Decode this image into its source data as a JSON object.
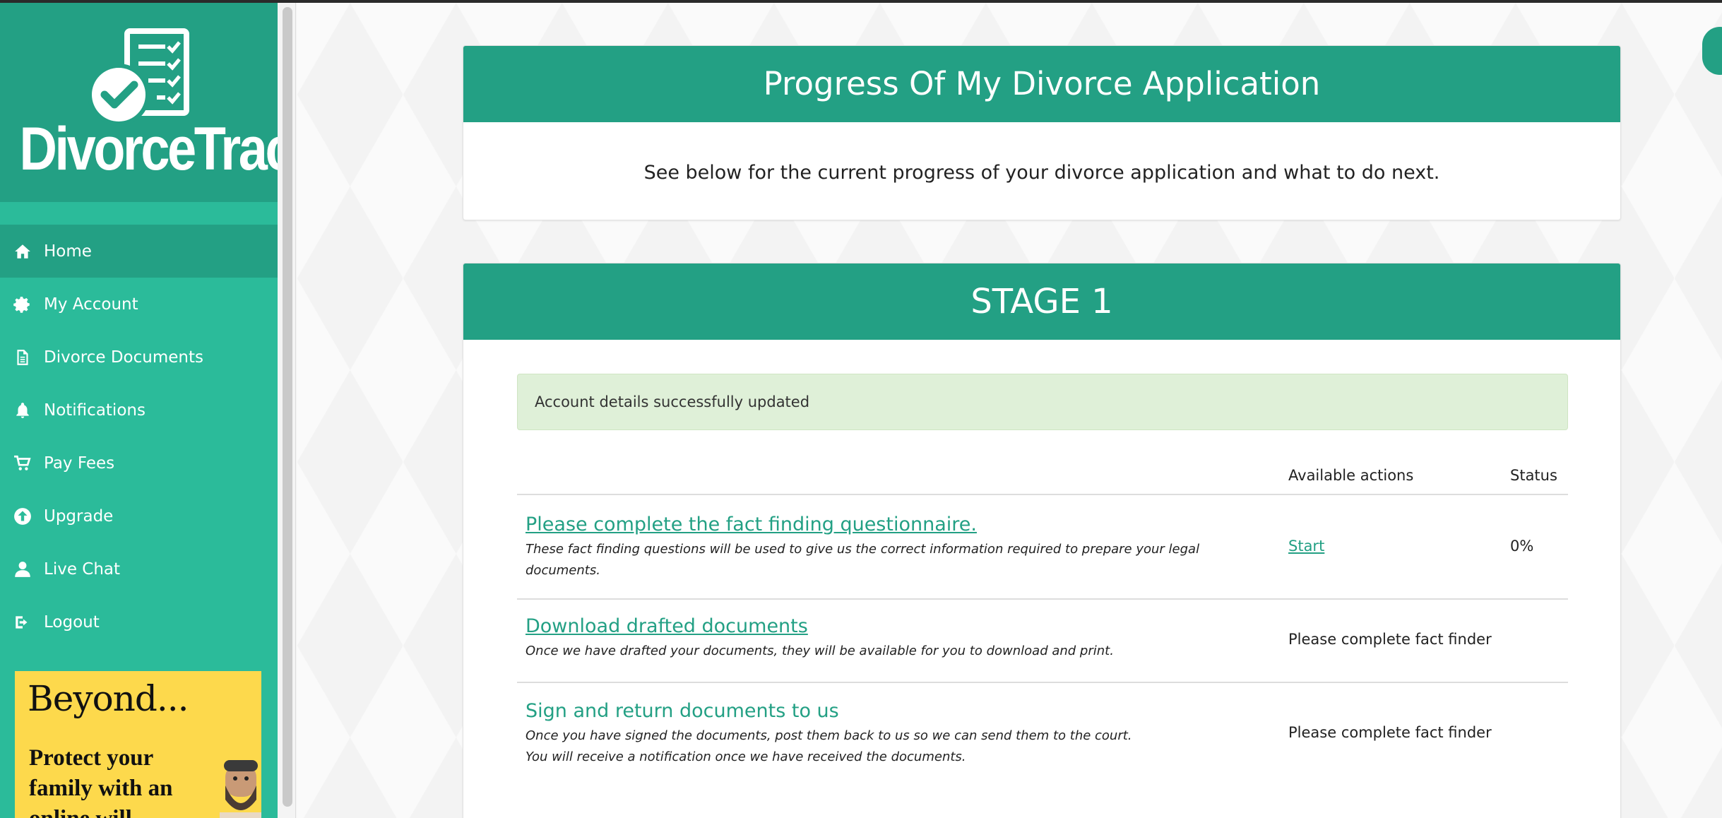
{
  "brand": {
    "name": "DivorceTrack"
  },
  "sidebar": {
    "items": [
      {
        "label": "Home",
        "icon": "home-icon",
        "active": true
      },
      {
        "label": "My Account",
        "icon": "gear-icon"
      },
      {
        "label": "Divorce Documents",
        "icon": "document-icon"
      },
      {
        "label": "Notifications",
        "icon": "bell-icon"
      },
      {
        "label": "Pay Fees",
        "icon": "cart-icon"
      },
      {
        "label": "Upgrade",
        "icon": "upload-icon"
      },
      {
        "label": "Live Chat",
        "icon": "user-icon"
      },
      {
        "label": "Logout",
        "icon": "logout-icon"
      }
    ]
  },
  "ad": {
    "title": "Beyond...",
    "body": "Protect your family with an online will"
  },
  "progress": {
    "title": "Progress Of My Divorce Application",
    "subtitle": "See below for the current progress of your divorce application and what to do next."
  },
  "stage": {
    "title": "STAGE 1",
    "alert": "Account details successfully updated",
    "headers": {
      "actions": "Available actions",
      "status": "Status"
    },
    "rows": [
      {
        "title": "Please complete the fact finding questionnaire.",
        "desc": "These fact finding questions will be used to give us the correct information required to prepare your legal documents.",
        "action": "Start",
        "status": "0%"
      },
      {
        "title": "Download drafted documents",
        "desc": "Once we have drafted your documents, they will be available for you to download and print.",
        "action": "Please complete fact finder",
        "status": ""
      },
      {
        "title": "Sign and return documents to us",
        "desc1": "Once you have signed the documents, post them back to us so we can send them to the court.",
        "desc2": "You will receive a notification once we have received the documents.",
        "action": "Please complete fact finder",
        "status": ""
      }
    ]
  },
  "colors": {
    "brand": "#23a084",
    "sidebar": "#2bbb9a",
    "alert_bg": "#dff0d8",
    "ad_bg": "#fdd94c"
  }
}
